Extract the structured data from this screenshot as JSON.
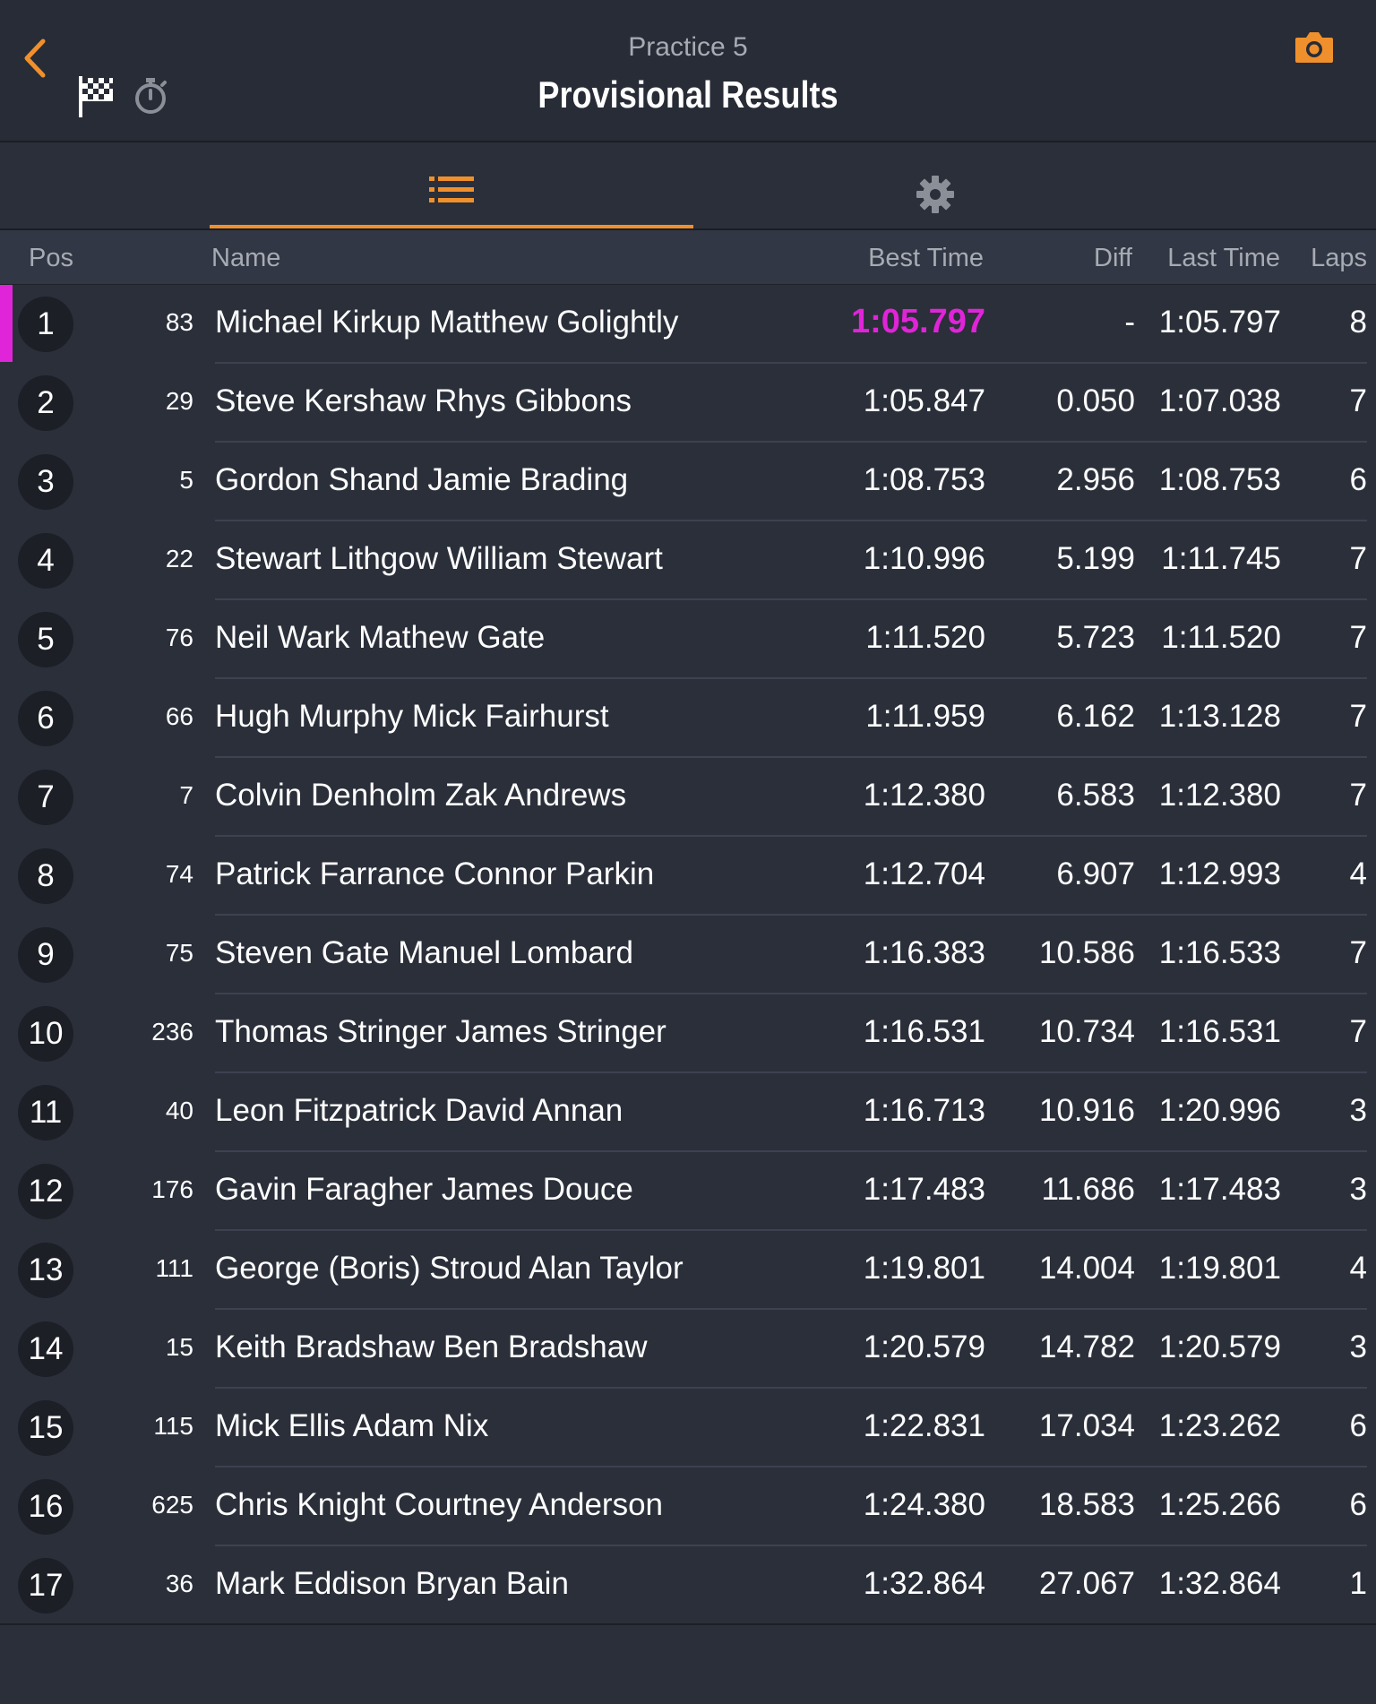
{
  "header": {
    "subtitle": "Practice 5",
    "title": "Provisional Results"
  },
  "columns": {
    "pos": "Pos",
    "name": "Name",
    "best": "Best Time",
    "diff": "Diff",
    "last": "Last Time",
    "laps": "Laps"
  },
  "colors": {
    "accent": "#f0902c",
    "fastest": "#e024d8",
    "background": "#2a2f3a"
  },
  "rows": [
    {
      "pos": "1",
      "num": "83",
      "name": "Michael Kirkup Matthew Golightly",
      "best": "1:05.797",
      "diff": "-",
      "last": "1:05.797",
      "laps": "8",
      "fastest": true
    },
    {
      "pos": "2",
      "num": "29",
      "name": "Steve Kershaw Rhys Gibbons",
      "best": "1:05.847",
      "diff": "0.050",
      "last": "1:07.038",
      "laps": "7"
    },
    {
      "pos": "3",
      "num": "5",
      "name": "Gordon Shand Jamie Brading",
      "best": "1:08.753",
      "diff": "2.956",
      "last": "1:08.753",
      "laps": "6"
    },
    {
      "pos": "4",
      "num": "22",
      "name": "Stewart Lithgow William Stewart",
      "best": "1:10.996",
      "diff": "5.199",
      "last": "1:11.745",
      "laps": "7"
    },
    {
      "pos": "5",
      "num": "76",
      "name": "Neil Wark Mathew Gate",
      "best": "1:11.520",
      "diff": "5.723",
      "last": "1:11.520",
      "laps": "7"
    },
    {
      "pos": "6",
      "num": "66",
      "name": "Hugh Murphy Mick Fairhurst",
      "best": "1:11.959",
      "diff": "6.162",
      "last": "1:13.128",
      "laps": "7"
    },
    {
      "pos": "7",
      "num": "7",
      "name": "Colvin Denholm Zak Andrews",
      "best": "1:12.380",
      "diff": "6.583",
      "last": "1:12.380",
      "laps": "7"
    },
    {
      "pos": "8",
      "num": "74",
      "name": "Patrick Farrance Connor Parkin",
      "best": "1:12.704",
      "diff": "6.907",
      "last": "1:12.993",
      "laps": "4"
    },
    {
      "pos": "9",
      "num": "75",
      "name": "Steven Gate Manuel Lombard",
      "best": "1:16.383",
      "diff": "10.586",
      "last": "1:16.533",
      "laps": "7"
    },
    {
      "pos": "10",
      "num": "236",
      "name": "Thomas Stringer James Stringer",
      "best": "1:16.531",
      "diff": "10.734",
      "last": "1:16.531",
      "laps": "7"
    },
    {
      "pos": "11",
      "num": "40",
      "name": "Leon Fitzpatrick David Annan",
      "best": "1:16.713",
      "diff": "10.916",
      "last": "1:20.996",
      "laps": "3"
    },
    {
      "pos": "12",
      "num": "176",
      "name": "Gavin Faragher James Douce",
      "best": "1:17.483",
      "diff": "11.686",
      "last": "1:17.483",
      "laps": "3"
    },
    {
      "pos": "13",
      "num": "111",
      "name": "George (Boris) Stroud Alan Taylor",
      "best": "1:19.801",
      "diff": "14.004",
      "last": "1:19.801",
      "laps": "4"
    },
    {
      "pos": "14",
      "num": "15",
      "name": "Keith Bradshaw Ben Bradshaw",
      "best": "1:20.579",
      "diff": "14.782",
      "last": "1:20.579",
      "laps": "3"
    },
    {
      "pos": "15",
      "num": "115",
      "name": "Mick Ellis Adam Nix",
      "best": "1:22.831",
      "diff": "17.034",
      "last": "1:23.262",
      "laps": "6"
    },
    {
      "pos": "16",
      "num": "625",
      "name": "Chris Knight Courtney Anderson",
      "best": "1:24.380",
      "diff": "18.583",
      "last": "1:25.266",
      "laps": "6"
    },
    {
      "pos": "17",
      "num": "36",
      "name": "Mark Eddison Bryan Bain",
      "best": "1:32.864",
      "diff": "27.067",
      "last": "1:32.864",
      "laps": "1"
    }
  ]
}
